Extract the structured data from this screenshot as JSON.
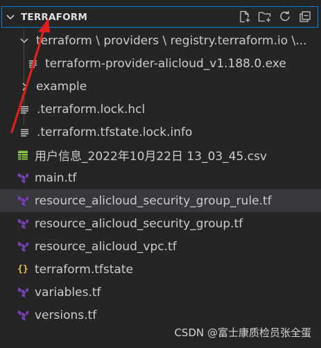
{
  "explorer": {
    "section_title": "TERRAFORM",
    "actions": [
      "new-file-icon",
      "new-folder-icon",
      "refresh-icon",
      "collapse-all-icon"
    ]
  },
  "tree": {
    "folder_path": "terraform \\ providers \\ registry.terraform.io \\...",
    "provider_exe": "terraform-provider-alicloud_v1.188.0.exe",
    "example_folder": "example",
    "files": [
      {
        "name": ".terraform.lock.hcl",
        "icon": "lines-icon"
      },
      {
        "name": ".terraform.tfstate.lock.info",
        "icon": "lines-icon"
      },
      {
        "name": "用户信息_2022年10月22日 13_03_45.csv",
        "icon": "table-icon"
      },
      {
        "name": "main.tf",
        "icon": "terraform-icon"
      },
      {
        "name": "resource_alicloud_security_group_rule.tf",
        "icon": "terraform-icon"
      },
      {
        "name": "resource_alicloud_security_group.tf",
        "icon": "terraform-icon"
      },
      {
        "name": "resource_alicloud_vpc.tf",
        "icon": "terraform-icon"
      },
      {
        "name": "terraform.tfstate",
        "icon": "json-icon"
      },
      {
        "name": "variables.tf",
        "icon": "terraform-icon"
      },
      {
        "name": "versions.tf",
        "icon": "terraform-icon"
      }
    ],
    "selected_file": "resource_alicloud_security_group_rule.tf"
  },
  "watermark": "CSDN @富士康质检员张全蛋",
  "colors": {
    "accent_border": "#007fd4",
    "terraform_purple": "#7b42bc",
    "csv_green": "#8bc34a",
    "json_yellow": "#e8c84a",
    "annotation_red": "#e0201b"
  }
}
